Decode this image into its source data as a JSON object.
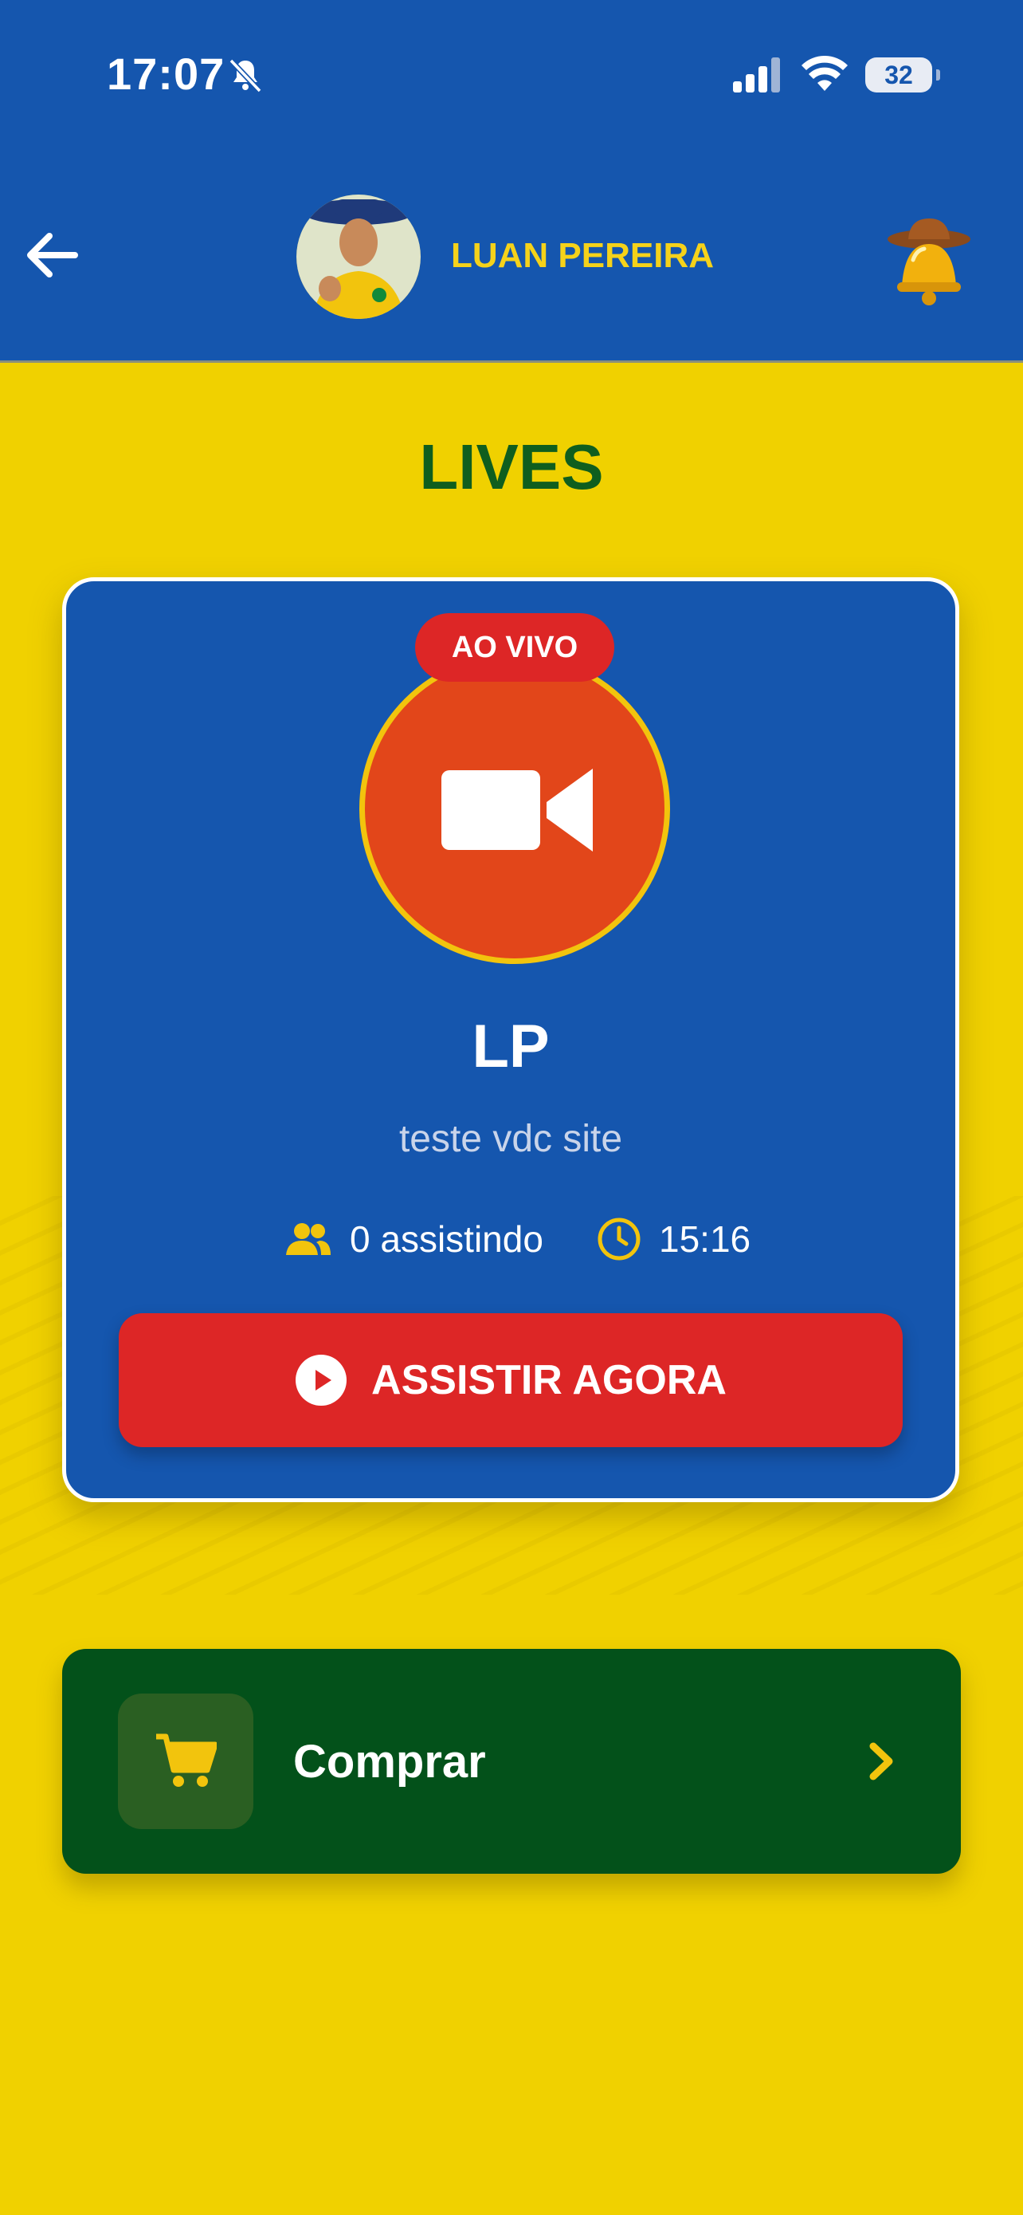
{
  "status_bar": {
    "time": "17:07",
    "battery": "32"
  },
  "header": {
    "name": "LUAN PEREIRA"
  },
  "page": {
    "title": "LIVES"
  },
  "live_card": {
    "badge": "AO VIVO",
    "title": "LP",
    "subtitle": "teste vdc site",
    "viewers": "0 assistindo",
    "time": "15:16",
    "watch_label": "ASSISTIR AGORA"
  },
  "comprar": {
    "label": "Comprar"
  },
  "icons": {
    "back": "arrow-left-icon",
    "bell": "cowboy-bell-icon",
    "camera": "video-camera-icon",
    "viewers": "users-icon",
    "clock": "clock-icon",
    "play": "play-circle-icon",
    "cart": "cart-icon",
    "chevron": "chevron-right-icon"
  },
  "colors": {
    "header_bg": "#1556AE",
    "page_bg": "#F0D100",
    "title_green": "#0F5E1E",
    "live_red": "#DD2626",
    "camera_orange": "#E2461A",
    "accent_yellow": "#F5D21A",
    "comprar_bg": "#03511A"
  }
}
